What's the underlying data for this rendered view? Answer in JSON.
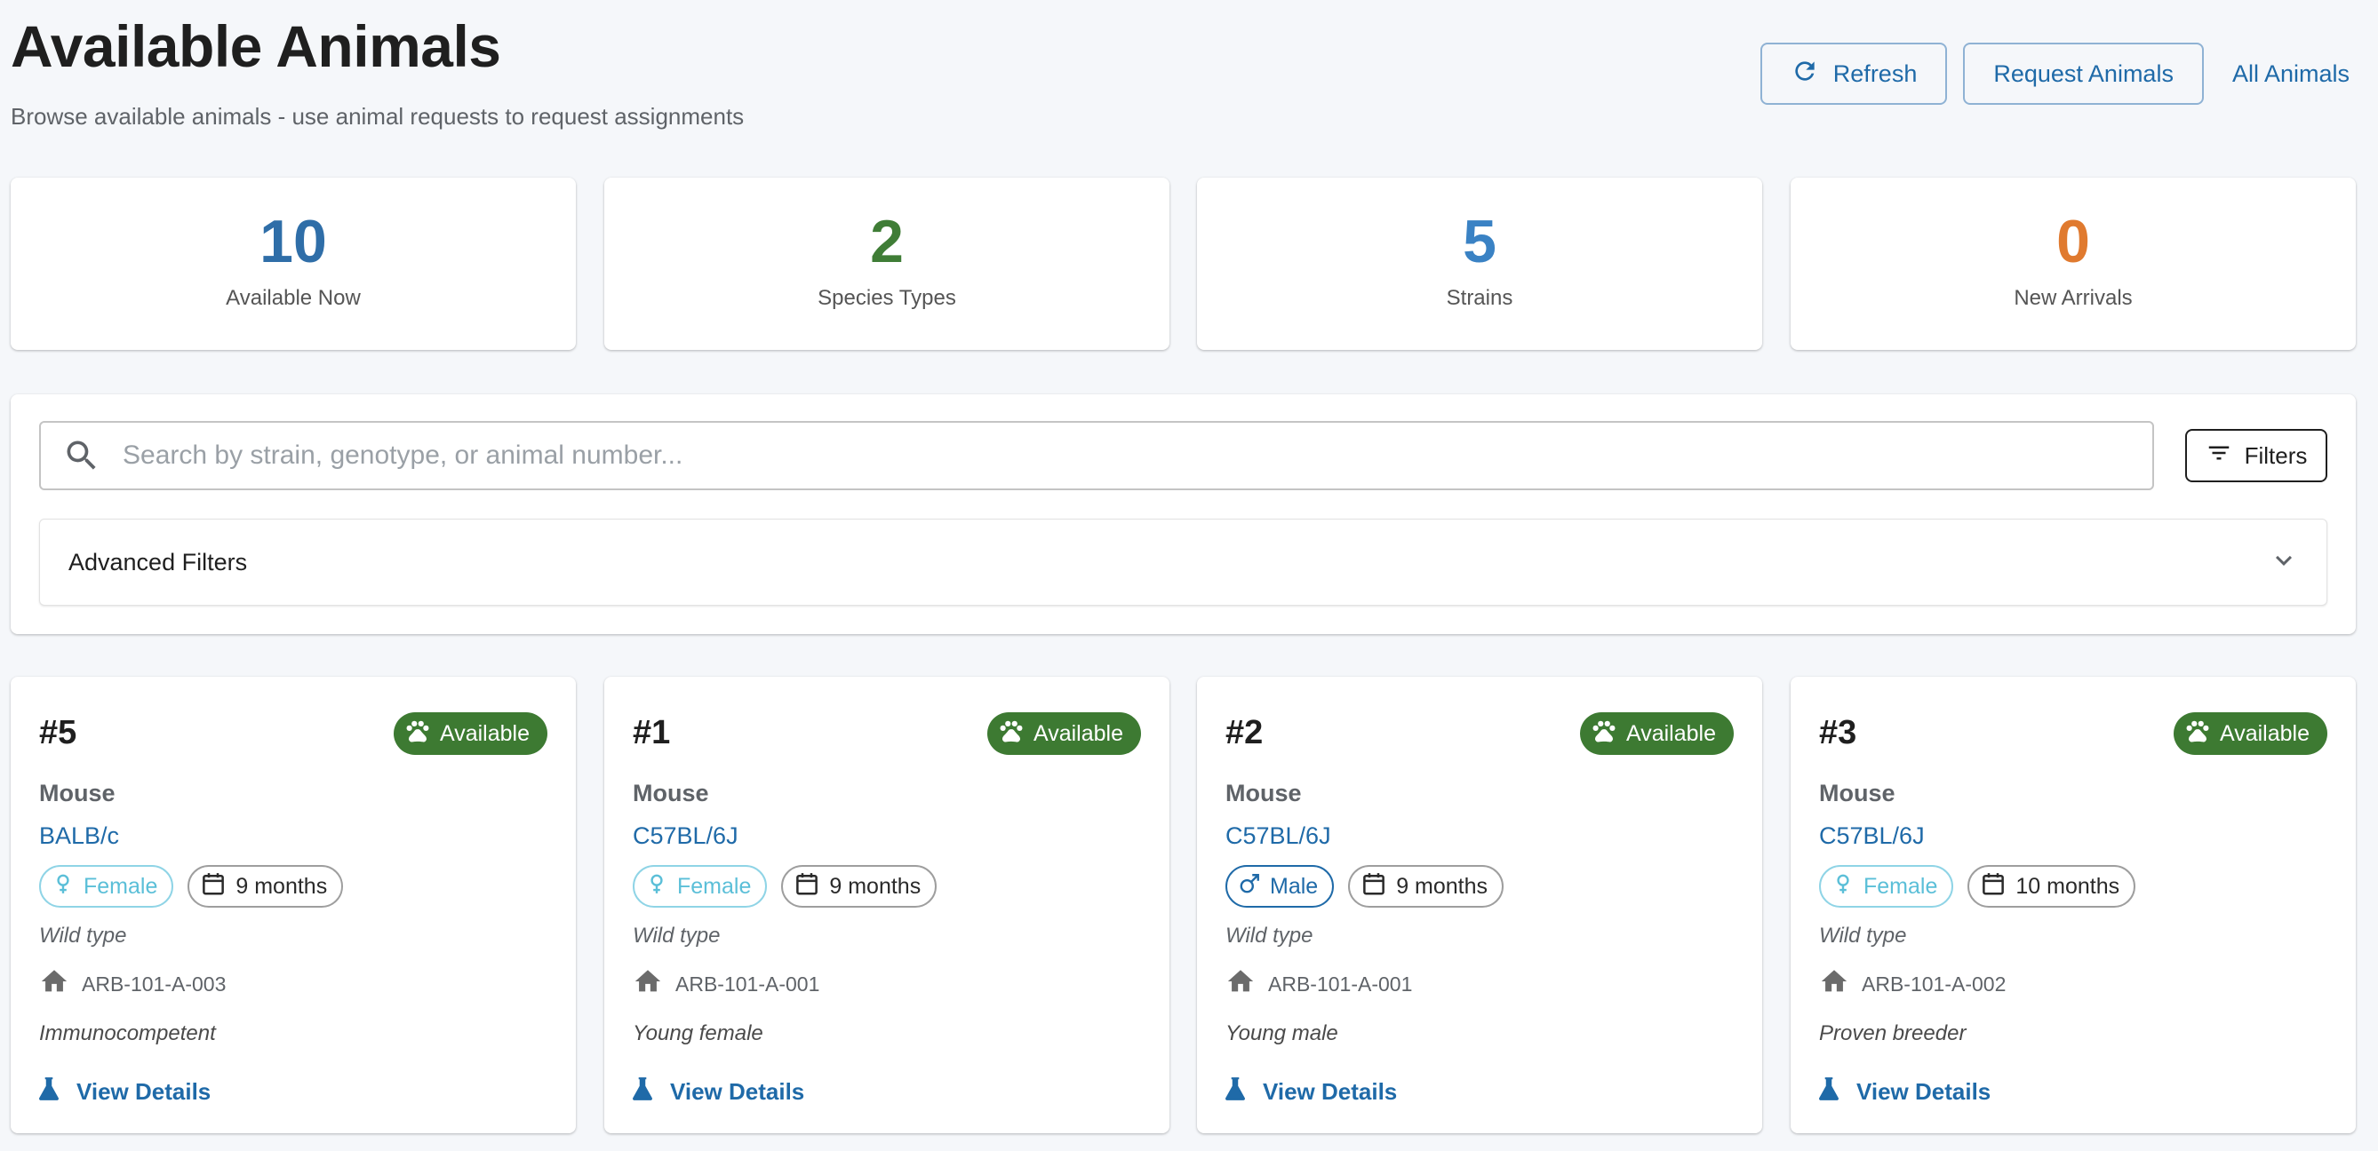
{
  "header": {
    "title": "Available Animals",
    "subtitle": "Browse available animals - use animal requests to request assignments",
    "refresh_label": "Refresh",
    "request_label": "Request Animals",
    "all_label": "All Animals"
  },
  "stats": [
    {
      "value": "10",
      "label": "Available Now",
      "color": "#2f6ea8"
    },
    {
      "value": "2",
      "label": "Species Types",
      "color": "#3f7d36"
    },
    {
      "value": "5",
      "label": "Strains",
      "color": "#3a82c4"
    },
    {
      "value": "0",
      "label": "New Arrivals",
      "color": "#e07a2f"
    }
  ],
  "search": {
    "placeholder": "Search by strain, genotype, or animal number...",
    "value": "",
    "filters_label": "Filters",
    "advanced_label": "Advanced Filters"
  },
  "animals": [
    {
      "number": "#5",
      "status": "Available",
      "species": "Mouse",
      "strain": "BALB/c",
      "sex": "Female",
      "age": "9 months",
      "genotype": "Wild type",
      "location": "ARB-101-A-003",
      "note": "Immunocompetent",
      "link": "View Details"
    },
    {
      "number": "#1",
      "status": "Available",
      "species": "Mouse",
      "strain": "C57BL/6J",
      "sex": "Female",
      "age": "9 months",
      "genotype": "Wild type",
      "location": "ARB-101-A-001",
      "note": "Young female",
      "link": "View Details"
    },
    {
      "number": "#2",
      "status": "Available",
      "species": "Mouse",
      "strain": "C57BL/6J",
      "sex": "Male",
      "age": "9 months",
      "genotype": "Wild type",
      "location": "ARB-101-A-001",
      "note": "Young male",
      "link": "View Details"
    },
    {
      "number": "#3",
      "status": "Available",
      "species": "Mouse",
      "strain": "C57BL/6J",
      "sex": "Female",
      "age": "10 months",
      "genotype": "Wild type",
      "location": "ARB-101-A-002",
      "note": "Proven breeder",
      "link": "View Details"
    }
  ],
  "icons": {
    "refresh": "refresh-icon",
    "search": "search-icon",
    "filters": "filter-list-icon",
    "expand": "chevron-down-icon",
    "status": "paw-icon",
    "female": "female-icon",
    "male": "male-icon",
    "age": "calendar-icon",
    "location": "home-icon",
    "details": "flask-icon"
  }
}
